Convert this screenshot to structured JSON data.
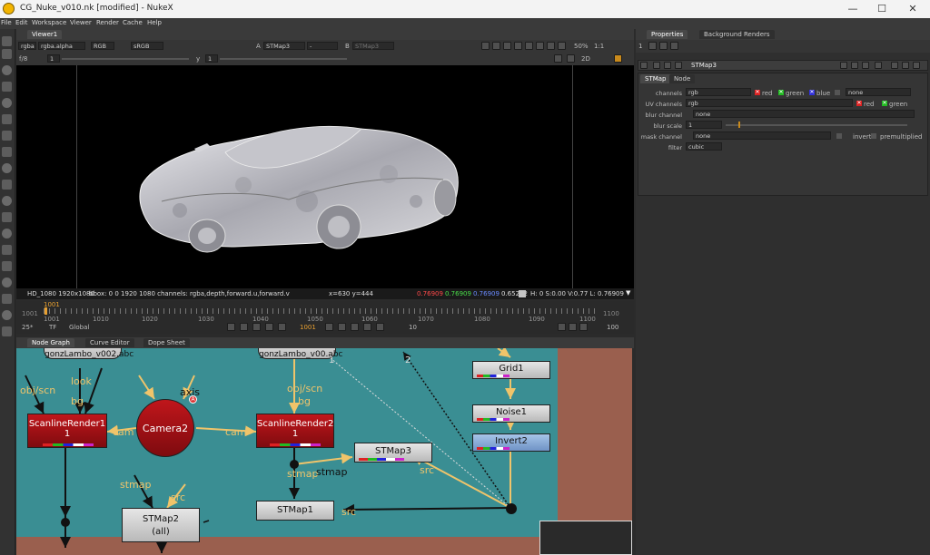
{
  "window": {
    "title": "CG_Nuke_v010.nk [modified] - NukeX",
    "controls": [
      "—",
      "☐",
      "✕"
    ]
  },
  "menu": [
    "File",
    "Edit",
    "Workspace",
    "Viewer",
    "Render",
    "Cache",
    "Help"
  ],
  "viewer": {
    "tab": "Viewer1",
    "layer": "rgba",
    "channel": "rgba.alpha",
    "display": "RGB",
    "lut": "sRGB",
    "input_a_label": "A",
    "input_a": "STMap3",
    "input_a_op": "-",
    "input_b_label": "B",
    "input_b": "STMap3",
    "zoom": "50%",
    "ratio": "1:1",
    "fstop_label": "f/8",
    "fstop_value": "1",
    "gamma_label": "y",
    "gamma_value": "1",
    "mode": "2D"
  },
  "viewer_info": {
    "format": "HD_1080 1920x1080",
    "bbox": "bbox: 0 0 1920 1080 channels: rgba,depth,forward.u,forward.v",
    "cursor": "x=630 y=444",
    "r": "0.76909",
    "g": "0.76909",
    "b": "0.76909",
    "a": "0.65292",
    "hsv": "H: 0 S:0.00 V:0.77  L: 0.76909"
  },
  "timeline": {
    "start": "1001",
    "end": "1100",
    "frame_marker": "1001",
    "ticks": [
      "1001",
      "1010",
      "1020",
      "1030",
      "1040",
      "1050",
      "1060",
      "1070",
      "1080",
      "1090",
      "1100"
    ],
    "fps": "25*",
    "tf": "TF",
    "global": "Global",
    "current_frame": "1001",
    "step": "10",
    "end_field": "100"
  },
  "panel_tabs": [
    "Node Graph",
    "Curve Editor",
    "Dope Sheet"
  ],
  "nodes": {
    "scanline1": "ScanlineRender1",
    "scanline1_sub": "1",
    "camera": "Camera2",
    "scanline2": "ScanlineRender2",
    "scanline2_sub": "1",
    "stmap3": "STMap3",
    "stmap1": "STMap1",
    "stmap2": "STMap2",
    "stmap2_sub": "(all)",
    "grid": "Grid1",
    "noise": "Noise1",
    "invert": "Invert2",
    "abc1": "gonzLambo_v002.abc",
    "abc2": "gonzLambo_v00.abc"
  },
  "edge_labels": {
    "objscn1": "obj/scn",
    "look": "look",
    "bg1": "bg",
    "cam1": "cam",
    "axis": "axis",
    "objscn2": "obj/scn",
    "bg2": "bg",
    "cam2": "cam",
    "stmap_a": "stmap",
    "stmap_b": "stmap",
    "src_a": "src",
    "src_b": "src",
    "stmap_c": "stmap",
    "src_c": "src",
    "one": "1",
    "two": "2"
  },
  "properties": {
    "tabs": [
      "Properties",
      "Background Renders"
    ],
    "node_name": "STMap3",
    "subtabs": [
      "STMap",
      "Node"
    ],
    "channels_label": "channels",
    "channels_value": "rgb",
    "uv_label": "UV channels",
    "uv_value": "rgb",
    "blur_channel_label": "blur channel",
    "blur_channel_value": "none",
    "blur_scale_label": "blur scale",
    "blur_scale_value": "1",
    "mask_label": "mask channel",
    "mask_value": "none",
    "filter_label": "filter",
    "filter_value": "cubic",
    "red": "red",
    "green": "green",
    "blue": "blue",
    "none": "none",
    "invert": "invert",
    "premultiplied": "premultiplied",
    "panel_count": "1"
  },
  "colors": {
    "node_graph_bg": "#3a8e93",
    "edge": "#f0c46a",
    "red_node": "#a51217"
  }
}
